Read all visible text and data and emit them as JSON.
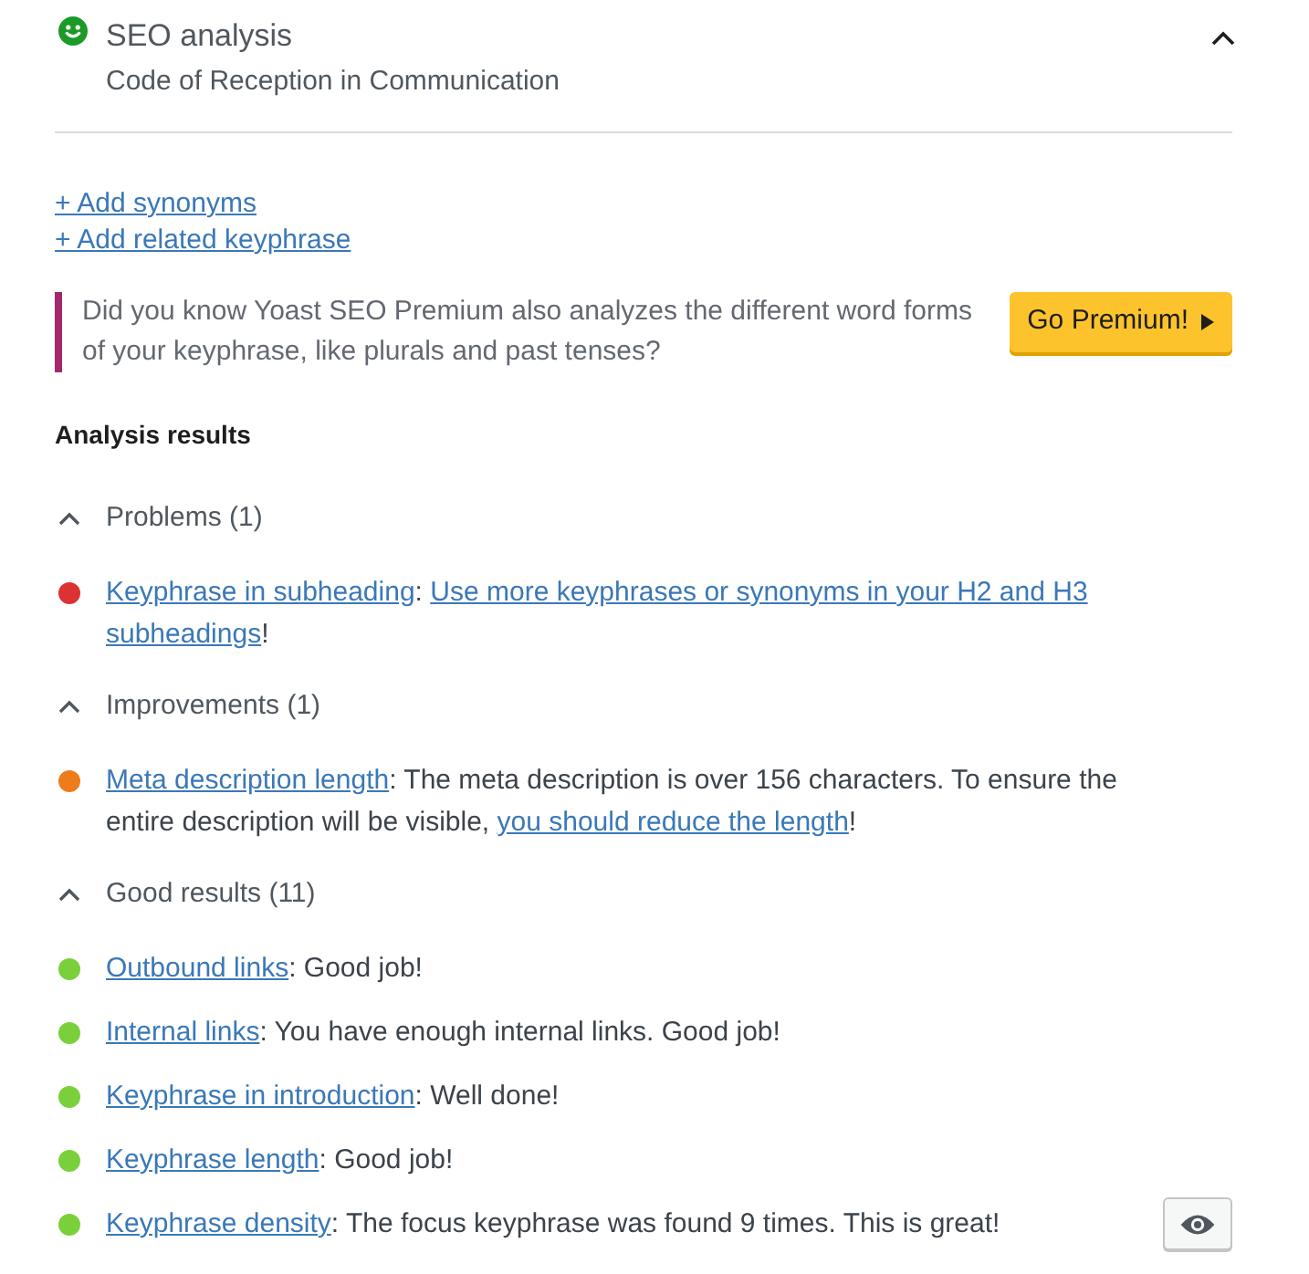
{
  "panel": {
    "color": "#1b9a28",
    "title": "SEO analysis",
    "subtitle": "Code of Reception in Communication",
    "expanded": true
  },
  "links": [
    "+ Add synonyms",
    "+ Add related keyphrase"
  ],
  "premium_notice": {
    "text": "Did you know Yoast SEO Premium also analyzes the different word forms of your keyphrase, like plurals and past tenses?",
    "button": "Go Premium!"
  },
  "analysis_heading": "Analysis results",
  "sections": [
    {
      "label": "Problems (1)",
      "expanded": true,
      "results": [
        {
          "color": "#dc3232",
          "marker_button": false,
          "parts": [
            {
              "kind": "link",
              "text": "Keyphrase in subheading"
            },
            {
              "kind": "text",
              "text": ": "
            },
            {
              "kind": "link",
              "text": "Use more keyphrases or synonyms in your H2 and H3 "
            },
            {
              "kind": "link",
              "text": "subheadings"
            },
            {
              "kind": "text",
              "text": "!"
            }
          ]
        }
      ]
    },
    {
      "label": "Improvements (1)",
      "expanded": true,
      "results": [
        {
          "color": "#ee7c1b",
          "marker_button": false,
          "parts": [
            {
              "kind": "link",
              "text": "Meta description length"
            },
            {
              "kind": "text",
              "text": ": The meta description is over 156 characters. To ensure the entire description will be visible, "
            },
            {
              "kind": "link",
              "text": "you should reduce the length"
            },
            {
              "kind": "text",
              "text": "!"
            }
          ]
        }
      ]
    },
    {
      "label": "Good results (11)",
      "expanded": true,
      "results": [
        {
          "color": "#7ad03a",
          "marker_button": false,
          "parts": [
            {
              "kind": "link",
              "text": "Outbound links"
            },
            {
              "kind": "text",
              "text": ": Good job!"
            }
          ]
        },
        {
          "color": "#7ad03a",
          "marker_button": false,
          "parts": [
            {
              "kind": "link",
              "text": "Internal links"
            },
            {
              "kind": "text",
              "text": ": You have enough internal links. Good job!"
            }
          ]
        },
        {
          "color": "#7ad03a",
          "marker_button": false,
          "parts": [
            {
              "kind": "link",
              "text": "Keyphrase in introduction"
            },
            {
              "kind": "text",
              "text": ": Well done!"
            }
          ]
        },
        {
          "color": "#7ad03a",
          "marker_button": false,
          "parts": [
            {
              "kind": "link",
              "text": "Keyphrase length"
            },
            {
              "kind": "text",
              "text": ": Good job!"
            }
          ]
        },
        {
          "color": "#7ad03a",
          "marker_button": true,
          "parts": [
            {
              "kind": "link",
              "text": "Keyphrase density"
            },
            {
              "kind": "text",
              "text": ": The focus keyphrase was found 9 times. This is great!"
            }
          ]
        }
      ]
    }
  ]
}
